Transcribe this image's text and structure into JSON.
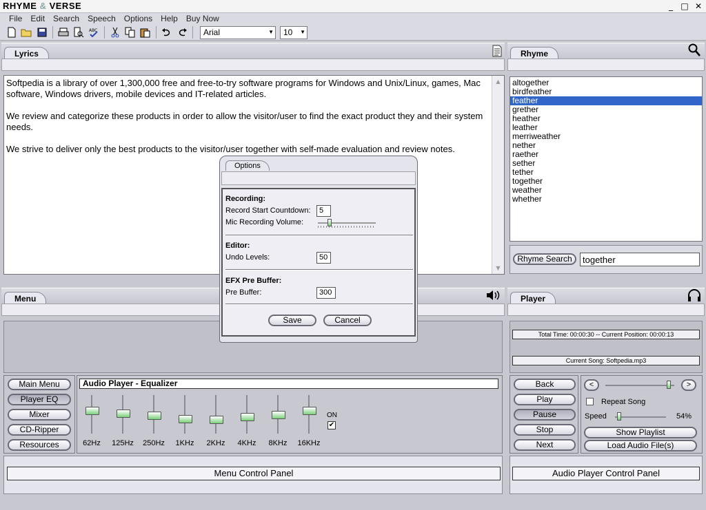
{
  "app": {
    "title_part1": "RHYME",
    "title_amp": "&",
    "title_part2": "VERSE",
    "min": "_",
    "max": "□",
    "close": "✕"
  },
  "menu": [
    "File",
    "Edit",
    "Search",
    "Speech",
    "Options",
    "Help",
    "Buy Now"
  ],
  "toolbar": {
    "font": "Arial",
    "size": "10"
  },
  "lyrics": {
    "tab": "Lyrics",
    "paragraphs": [
      "Softpedia is a library of over 1,300,000 free and free-to-try software programs for Windows and Unix/Linux, games, Mac software, Windows drivers, mobile devices and IT-related articles.",
      "We review and categorize these products in order to allow the visitor/user to find the exact product they and their system needs.",
      "We strive to deliver only the best products to the visitor/user together with self-made evaluation and review notes."
    ]
  },
  "rhyme": {
    "tab": "Rhyme",
    "words": [
      "altogether",
      "birdfeather",
      "feather",
      "grether",
      "heather",
      "leather",
      "merriweather",
      "nether",
      "raether",
      "sether",
      "tether",
      "together",
      "weather",
      "whether"
    ],
    "selected": "feather",
    "search_button": "Rhyme Search",
    "search_value": "together"
  },
  "options": {
    "tab": "Options",
    "recording_header": "Recording:",
    "countdown_label": "Record Start Countdown:",
    "countdown_value": "5",
    "mic_label": "Mic Recording Volume:",
    "mic_level": 0.18,
    "editor_header": "Editor:",
    "undo_label": "Undo Levels:",
    "undo_value": "50",
    "efx_header": "EFX Pre Buffer:",
    "prebuffer_label": "Pre Buffer:",
    "prebuffer_value": "300",
    "save": "Save",
    "cancel": "Cancel"
  },
  "menu_panel": {
    "tab": "Menu",
    "buttons": [
      "Main Menu",
      "Player EQ",
      "Mixer",
      "CD-Ripper",
      "Resources"
    ],
    "active": "Player EQ",
    "eq_title": "Audio Player - Equalizer",
    "bands": [
      {
        "label": "62Hz",
        "level": 0.55
      },
      {
        "label": "125Hz",
        "level": 0.47
      },
      {
        "label": "250Hz",
        "level": 0.4
      },
      {
        "label": "1KHz",
        "level": 0.3
      },
      {
        "label": "2KHz",
        "level": 0.28
      },
      {
        "label": "4KHz",
        "level": 0.37
      },
      {
        "label": "8KHz",
        "level": 0.43
      },
      {
        "label": "16KHz",
        "level": 0.55
      }
    ],
    "on_label": "ON",
    "on_check": "✔",
    "control_title": "Menu Control Panel"
  },
  "player": {
    "tab": "Player",
    "status_time": "Total Time: 00:00:30 -- Current Position: 00:00:13",
    "current_song": "Current Song: Softpedia.mp3",
    "buttons": [
      "Back",
      "Play",
      "Pause",
      "Stop",
      "Next"
    ],
    "active": "Pause",
    "prev": "<",
    "next": ">",
    "position": 0.95,
    "repeat_label": "Repeat Song",
    "speed_label": "Speed",
    "speed_value": "54%",
    "speed_level": 0.05,
    "show_playlist": "Show Playlist",
    "load_audio": "Load Audio File(s)",
    "control_title": "Audio Player Control Panel"
  },
  "colors": {
    "selection": "#3165c8",
    "eq_knob": "#7dd07d"
  }
}
